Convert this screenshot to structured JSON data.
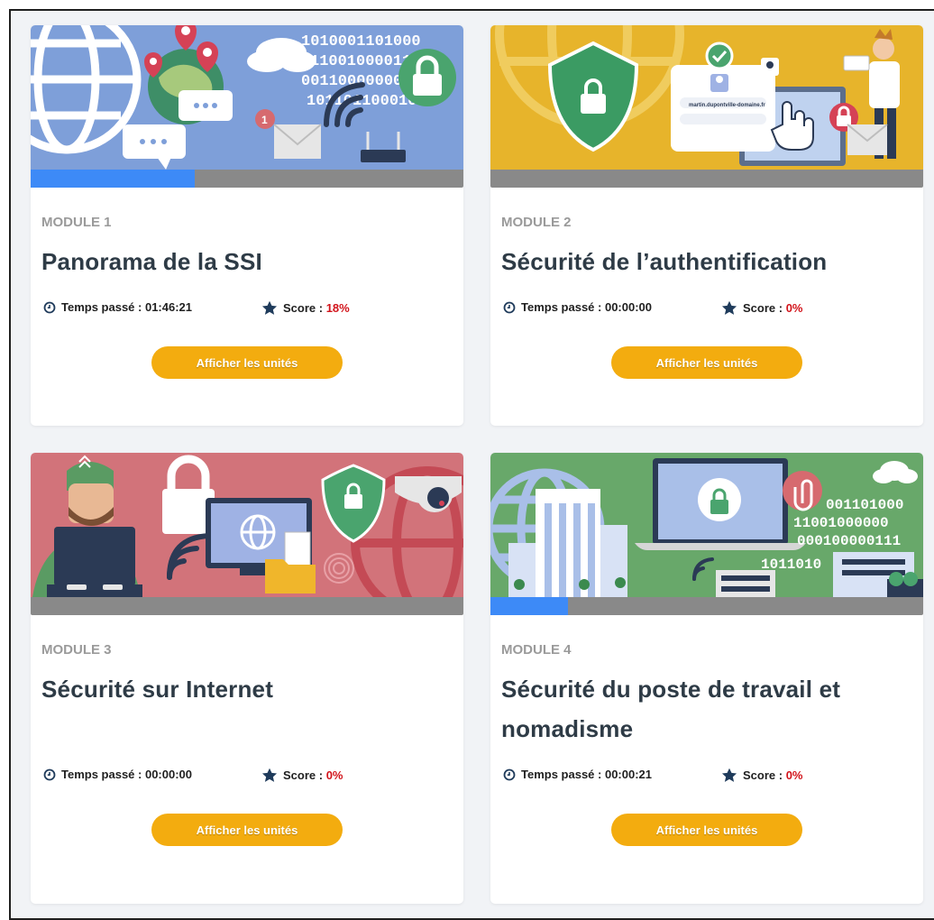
{
  "modules": [
    {
      "label": "MODULE 1",
      "title": "Panorama de la SSI",
      "time_label": "Temps passé : 01:46:21",
      "score_label": "Score : ",
      "score_value": "18%",
      "button_label": "Afficher les unités",
      "progress": 0.38,
      "banner_color": "#7e9fd9",
      "banner_text": "101000110100001100100001100110110"
    },
    {
      "label": "MODULE 2",
      "title": "Sécurité de l’authentification",
      "time_label": "Temps passé : 00:00:00",
      "score_label": "Score : ",
      "score_value": "0%",
      "button_label": "Afficher les unités",
      "progress": 0,
      "banner_color": "#e7b42b",
      "banner_text": "martin.dupontville-domaine.fr"
    },
    {
      "label": "MODULE 3",
      "title": "Sécurité sur Internet",
      "time_label": "Temps passé : 00:00:00",
      "score_label": "Score : ",
      "score_value": "0%",
      "button_label": "Afficher les unités",
      "progress": 0,
      "banner_color": "#d2737a",
      "banner_text": ""
    },
    {
      "label": "MODULE 4",
      "title": "Sécurité du poste de travail et nomadisme",
      "time_label": "Temps passé : 00:00:21",
      "score_label": "Score : ",
      "score_value": "0%",
      "button_label": "Afficher les unités",
      "progress": 0.18,
      "banner_color": "#68a86a",
      "banner_text": "00110100011001000000100000011110110"
    }
  ],
  "colors": {
    "accent_button": "#f3ac0f",
    "progress_fill": "#3d8af7",
    "progress_track": "#898989",
    "score_red": "#d2141b",
    "title": "#2e3b46"
  },
  "icons": [
    "clock-icon",
    "star-icon",
    "lock-icon",
    "globe-icon",
    "map-pin-icon",
    "envelope-icon",
    "shield-icon",
    "cloud-icon",
    "wifi-icon"
  ]
}
